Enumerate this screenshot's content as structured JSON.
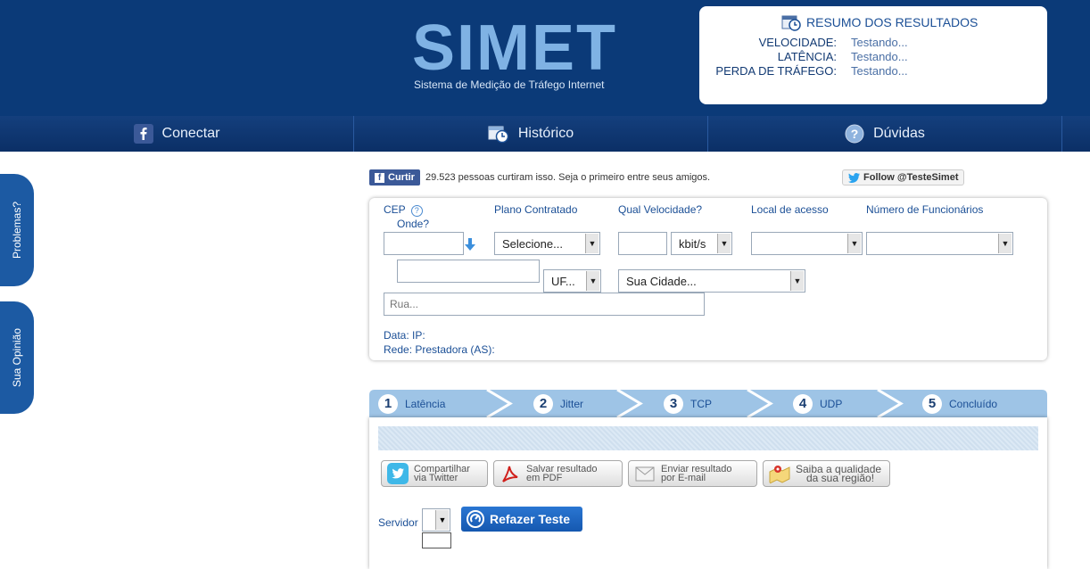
{
  "header": {
    "logo_text": "SIMET",
    "logo_subtitle": "Sistema de Medição de Tráfego Internet"
  },
  "summary": {
    "title": "RESUMO DOS RESULTADOS",
    "rows": [
      {
        "label": "VELOCIDADE:",
        "value": "Testando..."
      },
      {
        "label": "LATÊNCIA:",
        "value": "Testando..."
      },
      {
        "label": "PERDA DE TRÁFEGO:",
        "value": "Testando..."
      }
    ]
  },
  "nav": {
    "items": [
      {
        "label": "Conectar",
        "icon": "facebook-icon"
      },
      {
        "label": "Histórico",
        "icon": "history-icon"
      },
      {
        "label": "Dúvidas",
        "icon": "help-icon"
      }
    ]
  },
  "side_tabs": [
    "Problemas?",
    "Sua Opinião"
  ],
  "social": {
    "fb_button": "Curtir",
    "fb_text": "29.523 pessoas curtiram isso. Seja o primeiro entre seus amigos.",
    "twitter_button": "Follow @TesteSimet"
  },
  "form": {
    "cep_label": "CEP",
    "onde_label": "Onde?",
    "plano_label": "Plano Contratado",
    "velocidade_label": "Qual Velocidade?",
    "local_label": "Local de acesso",
    "funcionarios_label": "Número de Funcionários",
    "plano_value": "Selecione...",
    "unit_value": "kbit/s",
    "uf_value": "UF...",
    "cidade_value": "Sua Cidade...",
    "rua_placeholder": "Rua...",
    "data_ip": "Data: IP:",
    "rede": "Rede: Prestadora (AS):"
  },
  "steps": [
    {
      "num": "1",
      "label": "Latência"
    },
    {
      "num": "2",
      "label": "Jitter"
    },
    {
      "num": "3",
      "label": "TCP"
    },
    {
      "num": "4",
      "label": "UDP"
    },
    {
      "num": "5",
      "label": "Concluído"
    }
  ],
  "actions": {
    "twitter_line1": "Compartilhar",
    "twitter_line2": "via Twitter",
    "pdf_line1": "Salvar resultado",
    "pdf_line2": "em PDF",
    "email_line1": "Enviar resultado",
    "email_line2": "por E-mail",
    "region_line1": "Saiba a qualidade",
    "region_line2": "da sua região!",
    "servidor_label": "Servidor",
    "redo_button": "Refazer Teste"
  },
  "colors": {
    "header_bg": "#0b3a78",
    "accent": "#1b4f96",
    "step_bar": "#9ec4e6"
  }
}
